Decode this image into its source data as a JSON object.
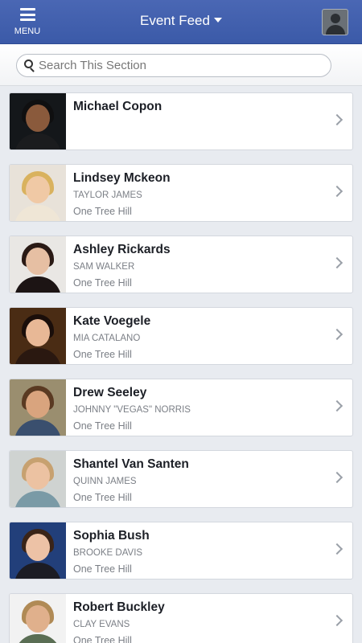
{
  "header": {
    "menu_label": "MENU",
    "title": "Event Feed",
    "menu_icon": "hamburger-icon",
    "profile_icon": "user-avatar-icon",
    "bar_color": "#3b5aa8"
  },
  "search": {
    "placeholder": "Search This Section",
    "value": ""
  },
  "people": [
    {
      "name": "Michael Copon",
      "role": "",
      "show": "",
      "photo_bg": "#14171a",
      "skin": "#8a5a3c",
      "hair": "#0f0f10",
      "shirt": "#1b1c1e"
    },
    {
      "name": "Lindsey Mckeon",
      "role": "TAYLOR JAMES",
      "show": "One Tree Hill",
      "photo_bg": "#e8e2d9",
      "skin": "#f0c9a5",
      "hair": "#d9b25e",
      "shirt": "#efe6d6"
    },
    {
      "name": "Ashley Rickards",
      "role": "SAM WALKER",
      "show": "One Tree Hill",
      "photo_bg": "#e9e7e4",
      "skin": "#e6bfa3",
      "hair": "#2a1a15",
      "shirt": "#1c1414"
    },
    {
      "name": "Kate Voegele",
      "role": "MIA CATALANO",
      "show": "One Tree Hill",
      "photo_bg": "#4a2c14",
      "skin": "#e8b896",
      "hair": "#1a0e0a",
      "shirt": "#2a1810"
    },
    {
      "name": "Drew Seeley",
      "role": "JOHNNY \"VEGAS\" NORRIS",
      "show": "One Tree Hill",
      "photo_bg": "#9a8e6f",
      "skin": "#d9a47e",
      "hair": "#5a3a22",
      "shirt": "#3a4f6e"
    },
    {
      "name": "Shantel Van Santen",
      "role": "QUINN JAMES",
      "show": "One Tree Hill",
      "photo_bg": "#cfd3d1",
      "skin": "#ecc2a2",
      "hair": "#c7a170",
      "shirt": "#7a9aa6"
    },
    {
      "name": "Sophia Bush",
      "role": "BROOKE DAVIS",
      "show": "One Tree Hill",
      "photo_bg": "#223f7a",
      "skin": "#edc2a6",
      "hair": "#3a2418",
      "shirt": "#1c1c24"
    },
    {
      "name": "Robert Buckley",
      "role": "CLAY EVANS",
      "show": "One Tree Hill",
      "photo_bg": "#f2f2f2",
      "skin": "#e0b08c",
      "hair": "#b08a55",
      "shirt": "#5a6e54"
    }
  ]
}
